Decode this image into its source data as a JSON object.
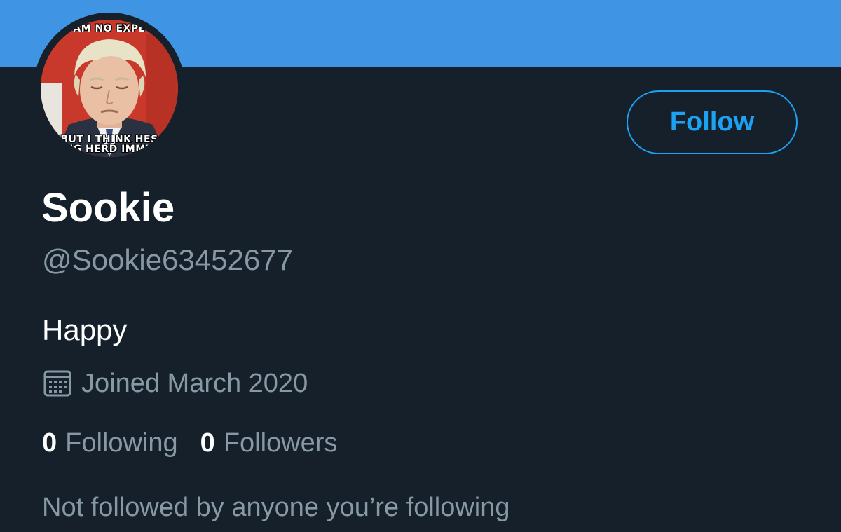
{
  "profile": {
    "display_name": "Sookie",
    "handle": "@Sookie63452677",
    "bio": "Happy",
    "joined": "Joined March 2020",
    "following_count": "0",
    "following_label": "Following",
    "followers_count": "0",
    "followers_label": "Followers",
    "mutuals_note": "Not followed by anyone you’re following"
  },
  "avatar": {
    "meme_top_text": "AM NO EXPE",
    "meme_bottom_line1": "BUT I THINK HES",
    "meme_bottom_line2": "NG HERD IMMU"
  },
  "actions": {
    "follow_label": "Follow"
  },
  "icons": {
    "calendar": "calendar-icon"
  },
  "colors": {
    "background": "#15202b",
    "banner": "#3f95e4",
    "accent": "#1da1f2",
    "secondary_text": "#8899a6",
    "primary_text": "#ffffff"
  }
}
